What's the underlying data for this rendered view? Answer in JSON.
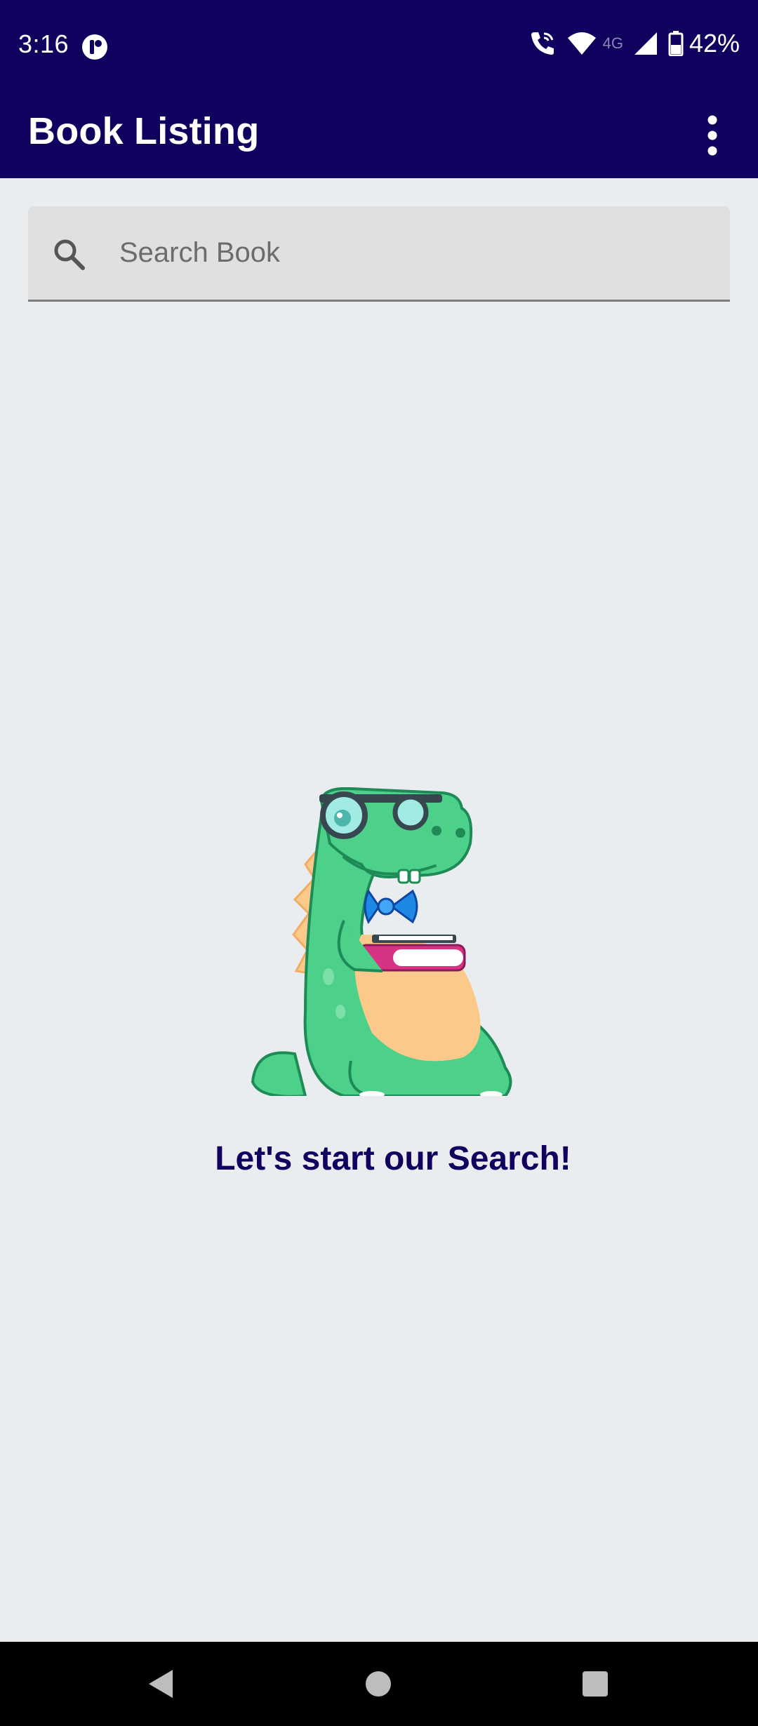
{
  "status_bar": {
    "time": "3:16",
    "network_type": "4G",
    "battery": "42%",
    "icons": [
      "app-notification-icon",
      "wifi-calling-icon",
      "wifi-icon",
      "signal-icon",
      "battery-icon"
    ]
  },
  "app_bar": {
    "title": "Book Listing",
    "menu_icon": "more-vert-icon"
  },
  "search": {
    "placeholder": "Search Book",
    "value": "",
    "icon": "search-icon"
  },
  "empty_state": {
    "illustration": "dinosaur-with-books",
    "message": "Let's start our Search!"
  },
  "navigation": {
    "buttons": [
      "back-icon",
      "home-icon",
      "recents-icon"
    ]
  },
  "colors": {
    "primary": "#12005e",
    "background": "#eaedf0",
    "search_field": "#e0e0e0",
    "mascot_green": "#4cd08a"
  }
}
